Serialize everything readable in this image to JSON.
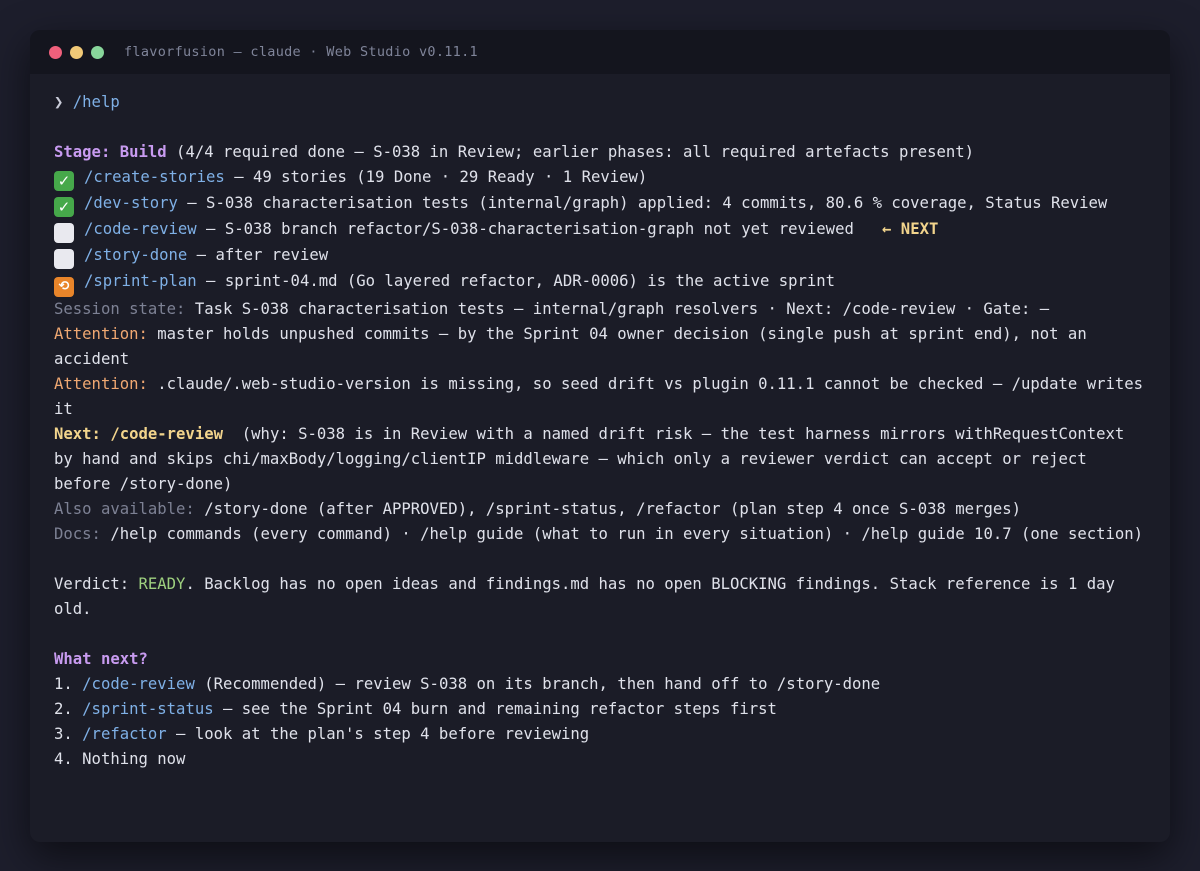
{
  "window": {
    "title": "flavorfusion — claude · Web Studio v0.11.1",
    "traffic_lights": [
      "#f0607c",
      "#f1c977",
      "#88d69b"
    ]
  },
  "prompt": {
    "symbol": "❯",
    "command": "/help"
  },
  "stage": {
    "label": "Stage: Build",
    "detail": " (4/4 required done — S-038 in Review; earlier phases: all required artefacts present)"
  },
  "steps": [
    {
      "icon": "check-mark-icon",
      "cmd": "/create-stories",
      "text": " — 49 stories (19 Done · 29 Ready · 1 Review)"
    },
    {
      "icon": "check-mark-icon",
      "cmd": "/dev-story",
      "text": " — S-038 characterisation tests (internal/graph) applied: 4 commits, 80.6 % coverage, Status Review"
    },
    {
      "icon": "empty-box-icon",
      "cmd": "/code-review",
      "text": " — S-038 branch refactor/S-038-characterisation-graph not yet reviewed",
      "next_marker": "   ← NEXT"
    },
    {
      "icon": "empty-box-icon",
      "cmd": "/story-done",
      "text": " — after review"
    },
    {
      "icon": "repeat-icon",
      "cmd": "/sprint-plan",
      "text": " — sprint-04.md (Go layered refactor, ADR-0006) is the active sprint"
    }
  ],
  "session": {
    "label": "Session state:",
    "text": " Task S-038 characterisation tests — internal/graph resolvers · Next: /code-review · Gate: —"
  },
  "attention": [
    {
      "label": "Attention:",
      "text": " master holds unpushed commits — by the Sprint 04 owner decision (single push at sprint end), not an accident"
    },
    {
      "label": "Attention:",
      "text": " .claude/.web-studio-version is missing, so seed drift vs plugin 0.11.1 cannot be checked — /update writes it"
    }
  ],
  "next": {
    "label": "Next: /code-review",
    "text": "  (why: S-038 is in Review with a named drift risk — the test harness mirrors withRequestContext by hand and skips chi/maxBody/logging/clientIP middleware — which only a reviewer verdict can accept or reject before /story-done)"
  },
  "also": {
    "label": "Also available:",
    "text": " /story-done (after APPROVED), /sprint-status, /refactor (plan step 4 once S-038 merges)"
  },
  "docs": {
    "label": "Docs:",
    "text": " /help commands (every command) · /help guide (what to run in every situation) · /help guide 10.7 (one section)"
  },
  "verdict": {
    "label": "Verdict: ",
    "status": "READY",
    "text": ". Backlog has no open ideas and findings.md has no open BLOCKING findings. Stack reference is 1 day old."
  },
  "what_next": {
    "heading": "What next?",
    "options": [
      {
        "num": "1. ",
        "cmd": "/code-review",
        "text": " (Recommended) — review S-038 on its branch, then hand off to /story-done"
      },
      {
        "num": "2. ",
        "cmd": "/sprint-status",
        "text": " — see the Sprint 04 burn and remaining refactor steps first"
      },
      {
        "num": "3. ",
        "cmd": "/refactor",
        "text": " — look at the plan's step 4 before reviewing"
      },
      {
        "num": "4. ",
        "cmd": "",
        "text": "Nothing now"
      }
    ]
  }
}
